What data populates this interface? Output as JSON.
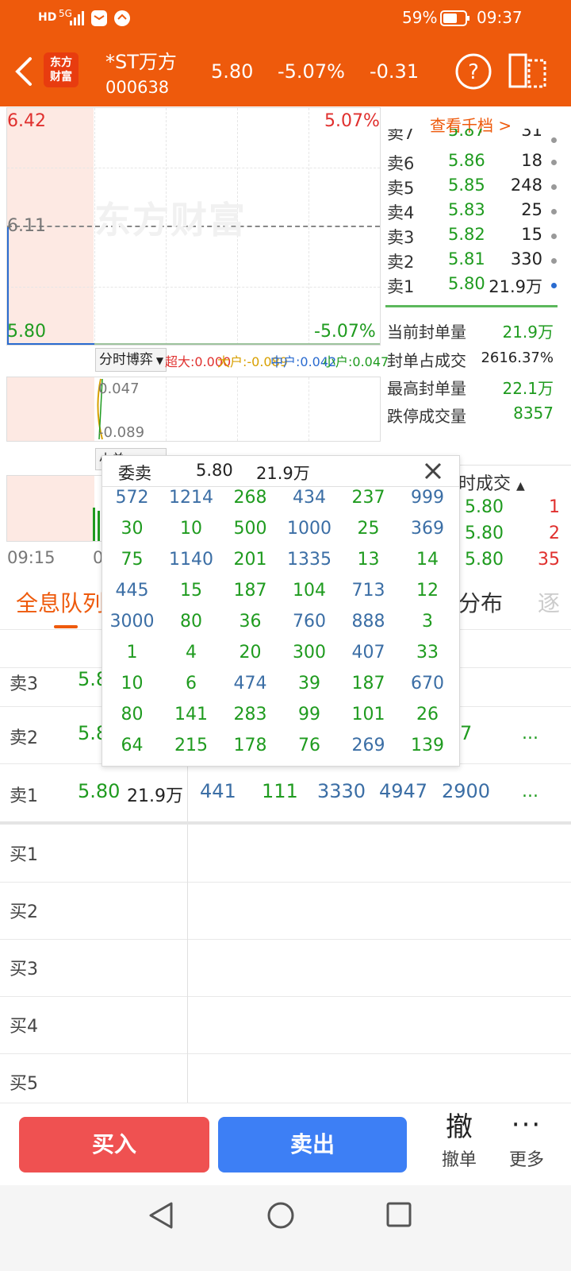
{
  "status": {
    "hd": "HD",
    "net": "5G",
    "battery": "59%",
    "time": "09:37"
  },
  "header": {
    "logo_line1": "东方",
    "logo_line2": "财富",
    "name": "*ST万方",
    "code": "000638",
    "price": "5.80",
    "change_pct": "-5.07%",
    "change": "-0.31"
  },
  "chart": {
    "high": "6.42",
    "high_pct": "5.07%",
    "mid": "6.11",
    "low": "5.80",
    "low_pct": "-5.07%",
    "watermark": "东方财富",
    "time_start": "09:15",
    "time_mid": "0"
  },
  "indicator": {
    "selector": "分时博弈",
    "super": "超大:0.000",
    "big": "大户:-0.089",
    "mid": "中户:0.042",
    "small": "小户:0.047",
    "v1": "0.047",
    "v2": "-0.089",
    "sel2": "小单"
  },
  "orderbook": {
    "link": "查看千档 >",
    "rows": [
      {
        "label": "卖7",
        "price": "5.87",
        "vol": "31"
      },
      {
        "label": "卖6",
        "price": "5.86",
        "vol": "18"
      },
      {
        "label": "卖5",
        "price": "5.85",
        "vol": "248"
      },
      {
        "label": "卖4",
        "price": "5.83",
        "vol": "25"
      },
      {
        "label": "卖3",
        "price": "5.82",
        "vol": "15"
      },
      {
        "label": "卖2",
        "price": "5.81",
        "vol": "330"
      },
      {
        "label": "卖1",
        "price": "5.80",
        "vol": "21.9万"
      }
    ]
  },
  "info": [
    {
      "label": "当前封单量",
      "value": "21.9万"
    },
    {
      "label": "封单占成交",
      "value": "2616.37%"
    },
    {
      "label": "最高封单量",
      "value": "22.1万"
    },
    {
      "label": "跌停成交量",
      "value": "8357"
    }
  ],
  "ticks": {
    "header": "时成交",
    "rows": [
      {
        "price": "5.80",
        "vol": "1"
      },
      {
        "price": "5.80",
        "vol": "2"
      },
      {
        "price": "5.80",
        "vol": "35"
      }
    ]
  },
  "tabs": {
    "t1": "全息队列",
    "t2": "分布",
    "t3": "逐"
  },
  "queue": {
    "s3": {
      "label": "卖3",
      "price": "5.8"
    },
    "s2": {
      "label": "卖2",
      "price": "5.8",
      "tail": "7",
      "more": "..."
    },
    "s1": {
      "label": "卖1",
      "price": "5.80",
      "vol": "21.9万",
      "orders": [
        "441",
        "111",
        "3330",
        "4947",
        "2900"
      ],
      "more": "..."
    },
    "buys": [
      "买1",
      "买2",
      "买3",
      "买4",
      "买5"
    ]
  },
  "popup": {
    "title": "委卖",
    "price": "5.80",
    "vol": "21.9万",
    "rows": [
      [
        "572",
        "1214",
        "268",
        "434",
        "237",
        "999"
      ],
      [
        "30",
        "10",
        "500",
        "1000",
        "25",
        "369"
      ],
      [
        "75",
        "1140",
        "201",
        "1335",
        "13",
        "14"
      ],
      [
        "445",
        "15",
        "187",
        "104",
        "713",
        "12"
      ],
      [
        "3000",
        "80",
        "36",
        "760",
        "888",
        "3"
      ],
      [
        "1",
        "4",
        "20",
        "300",
        "407",
        "33"
      ],
      [
        "10",
        "6",
        "474",
        "39",
        "187",
        "670"
      ],
      [
        "80",
        "141",
        "283",
        "99",
        "101",
        "26"
      ],
      [
        "64",
        "215",
        "178",
        "76",
        "269",
        "139"
      ]
    ],
    "colors": [
      [
        "b",
        "b",
        "g",
        "b",
        "g",
        "b"
      ],
      [
        "g",
        "g",
        "g",
        "b",
        "g",
        "b"
      ],
      [
        "g",
        "b",
        "g",
        "b",
        "g",
        "g"
      ],
      [
        "b",
        "g",
        "g",
        "g",
        "b",
        "g"
      ],
      [
        "b",
        "g",
        "g",
        "b",
        "b",
        "g"
      ],
      [
        "g",
        "g",
        "g",
        "g",
        "b",
        "g"
      ],
      [
        "g",
        "g",
        "b",
        "g",
        "g",
        "b"
      ],
      [
        "g",
        "g",
        "g",
        "g",
        "g",
        "g"
      ],
      [
        "g",
        "g",
        "g",
        "g",
        "b",
        "g"
      ]
    ]
  },
  "bottom": {
    "buy": "买入",
    "sell": "卖出",
    "cancel_icon": "撤",
    "cancel": "撤单",
    "more": "更多"
  }
}
